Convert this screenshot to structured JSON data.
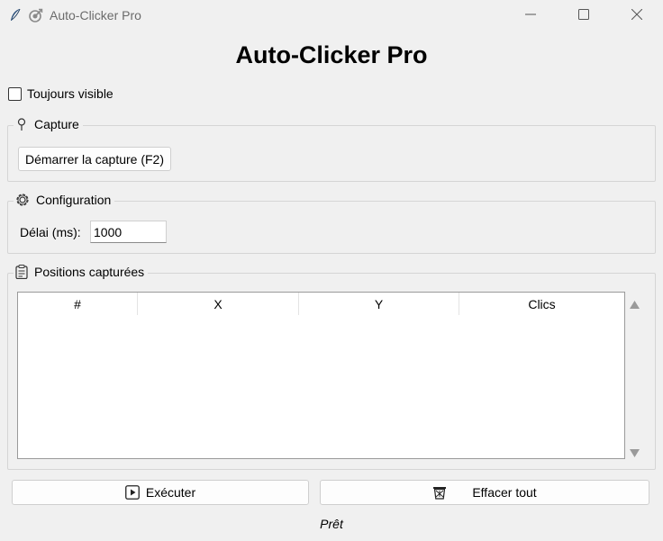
{
  "window": {
    "title": "Auto-Clicker Pro",
    "icons": [
      "feather-icon",
      "target-icon"
    ],
    "controls": [
      "minimize-icon",
      "maximize-icon",
      "close-icon"
    ]
  },
  "header": {
    "title": "Auto-Clicker Pro"
  },
  "options": {
    "always_on_top_label": "Toujours visible",
    "always_on_top_checked": false
  },
  "capture": {
    "group_label": "Capture",
    "icon": "pin-icon",
    "start_button_label": "Démarrer la capture (F2)"
  },
  "config": {
    "group_label": "Configuration",
    "icon": "gear-icon",
    "delay_label": "Délai (ms):",
    "delay_value": "1000"
  },
  "positions": {
    "group_label": "Positions capturées",
    "icon": "clipboard-icon",
    "columns": [
      "#",
      "X",
      "Y",
      "Clics"
    ],
    "rows": []
  },
  "actions": {
    "execute_label": "Exécuter",
    "execute_icon": "play-icon",
    "clear_label": "Effacer tout",
    "clear_icon": "trash-icon"
  },
  "status": {
    "text": "Prêt"
  }
}
